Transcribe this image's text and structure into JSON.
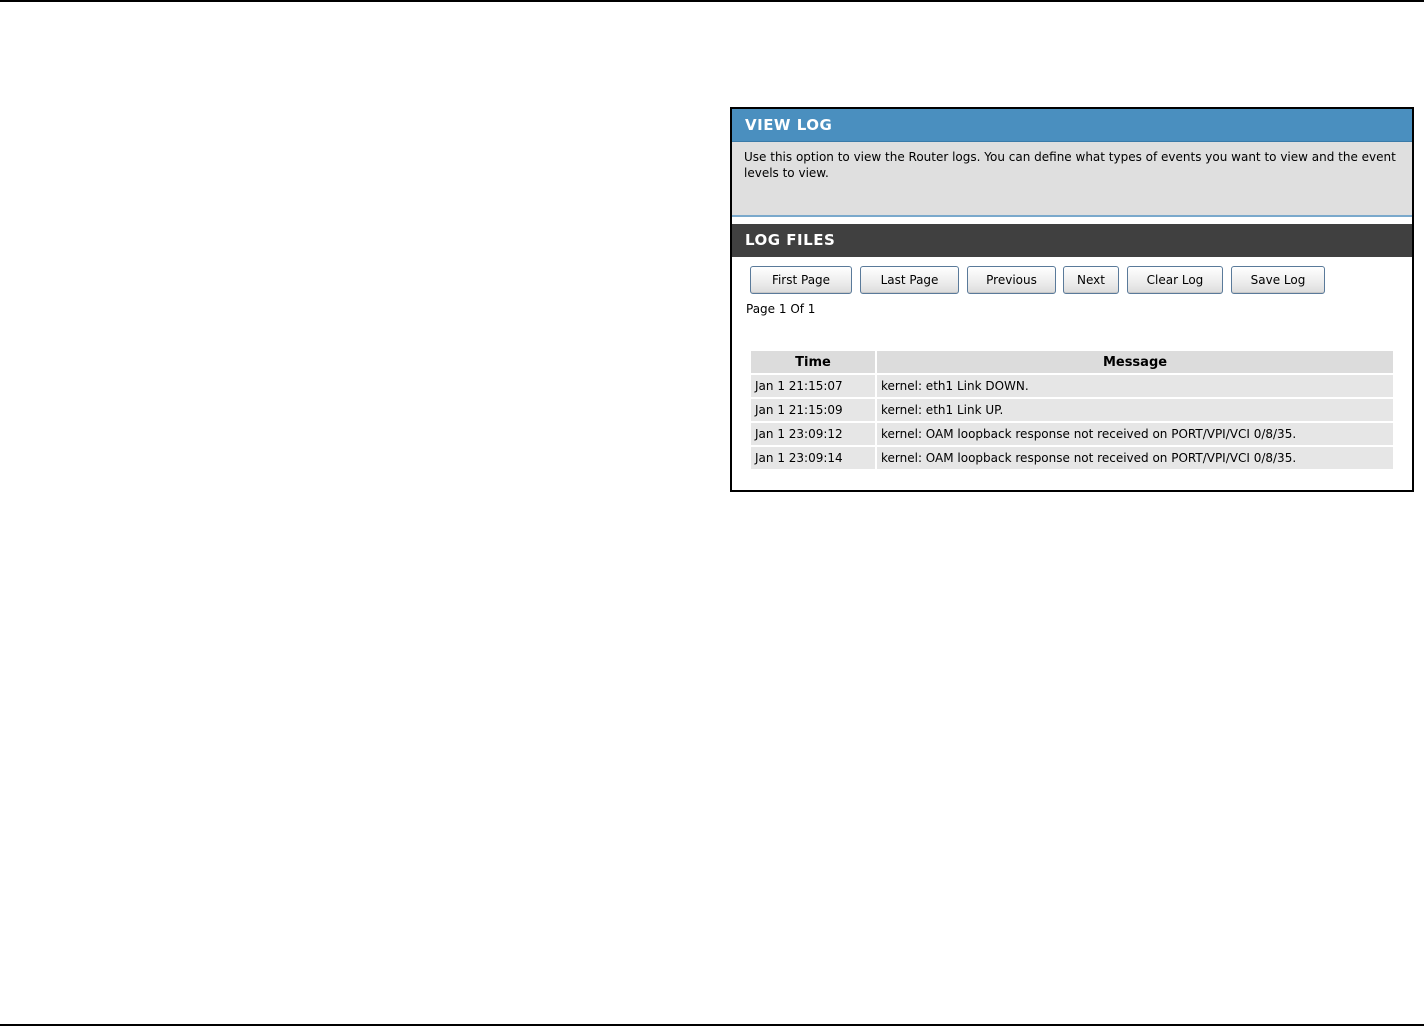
{
  "view_log": {
    "title": "VIEW LOG",
    "description": "Use this option to view the Router logs. You can define what types of events you want to view and the event levels to view."
  },
  "log_files": {
    "title": "LOG FILES",
    "buttons": {
      "first_page": "First Page",
      "last_page": "Last Page",
      "previous": "Previous",
      "next": "Next",
      "clear_log": "Clear Log",
      "save_log": "Save Log"
    },
    "page_info": "Page 1 Of 1",
    "table": {
      "headers": {
        "time": "Time",
        "message": "Message"
      },
      "rows": [
        {
          "time": "Jan 1 21:15:07",
          "message": "kernel: eth1 Link DOWN."
        },
        {
          "time": "Jan 1 21:15:09",
          "message": "kernel: eth1 Link UP."
        },
        {
          "time": "Jan 1 23:09:12",
          "message": "kernel: OAM loopback response not received on PORT/VPI/VCI 0/8/35."
        },
        {
          "time": "Jan 1 23:09:14",
          "message": "kernel: OAM loopback response not received on PORT/VPI/VCI 0/8/35."
        }
      ]
    }
  },
  "colors": {
    "view_header": "#4a8fbf",
    "log_header": "#404040",
    "description_bg": "#dfdfdf"
  }
}
